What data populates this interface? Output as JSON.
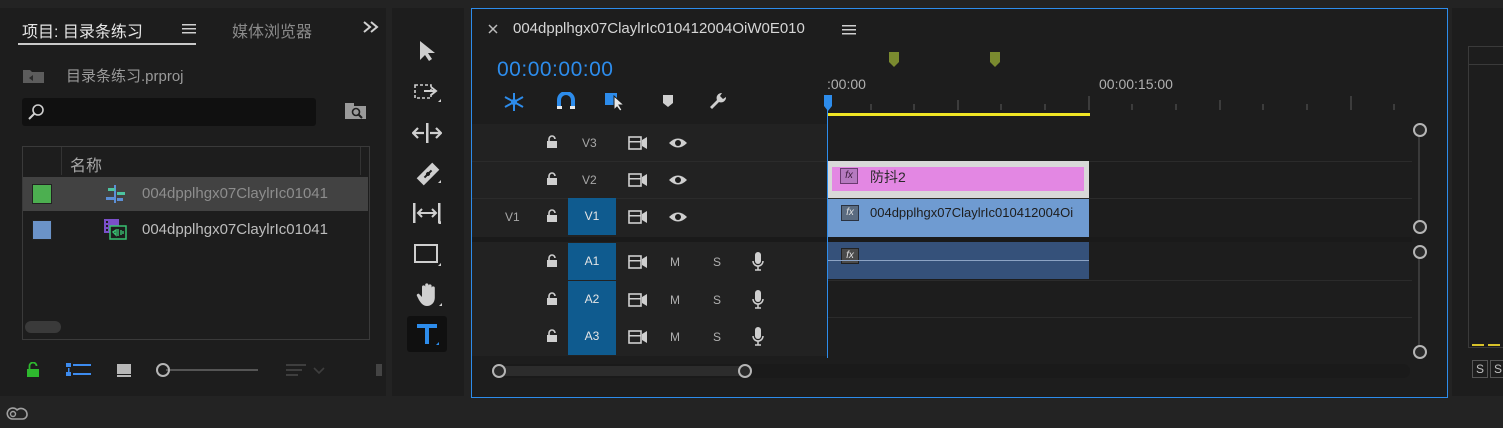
{
  "project_panel": {
    "tab_project": "项目: 目录条练习",
    "tab_media": "媒体浏览器",
    "project_file": "目录条练习.prproj",
    "search_placeholder": "",
    "column_name": "名称",
    "items": [
      {
        "name": "004dpplhgx07ClaylrIc01041",
        "color": "#4caf50",
        "icon": "sequence-icon"
      },
      {
        "name": "004dpplhgx07ClaylrIc01041",
        "color": "#6b93c8",
        "icon": "video-clip-icon"
      }
    ]
  },
  "timeline": {
    "sequence_name": "004dpplhgx07ClaylrIc010412004OiW0E010",
    "timecode": "00:00:00:00",
    "ruler": [
      ":00:00",
      "00:00:15:00"
    ],
    "video_tracks": [
      {
        "id": "V3",
        "source": ""
      },
      {
        "id": "V2",
        "source": ""
      },
      {
        "id": "V1",
        "source": "V1"
      }
    ],
    "audio_tracks": [
      {
        "id": "A1",
        "m": "M",
        "s": "S"
      },
      {
        "id": "A2",
        "m": "M",
        "s": "S"
      },
      {
        "id": "A3",
        "m": "M",
        "s": "S"
      }
    ],
    "clips": {
      "v2_label": "防抖2",
      "v1_label": "004dpplhgx07ClaylrIc010412004Oi",
      "fx": "fx"
    }
  },
  "meter_labels": [
    "S",
    "S"
  ],
  "colors": {
    "accent": "#2d8ceb",
    "pink_clip": "#e387e3",
    "blue_clip": "#6f9bd1",
    "audio_clip": "#35517a",
    "track_target": "#0f5b8f",
    "work_area": "#ffff00"
  }
}
